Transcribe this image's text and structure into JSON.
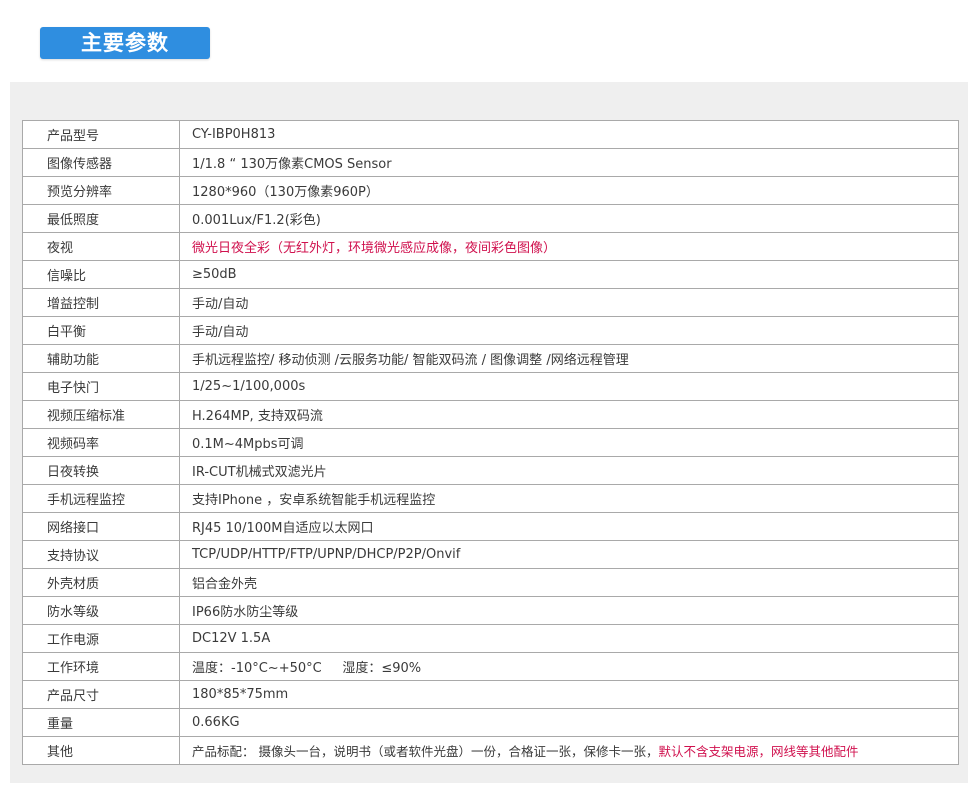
{
  "header": {
    "title": "主要参数"
  },
  "specs": [
    {
      "label": "产品型号",
      "value": "CY-IBP0H813"
    },
    {
      "label": "图像传感器",
      "value": "1/1.8 “ 130万像素CMOS Sensor"
    },
    {
      "label": "预览分辨率",
      "value": "1280*960（130万像素960P）"
    },
    {
      "label": "最低照度",
      "value": "0.001Lux/F1.2(彩色)"
    },
    {
      "label": "夜视",
      "value_highlight": "微光日夜全彩（无红外灯，环境微光感应成像，夜间彩色图像）"
    },
    {
      "label": "信噪比",
      "value": "≥50dB"
    },
    {
      "label": "增益控制",
      "value": "手动/自动"
    },
    {
      "label": "白平衡",
      "value": "手动/自动"
    },
    {
      "label": "辅助功能",
      "value": "手机远程监控/ 移动侦测 /云服务功能/ 智能双码流 / 图像调整 /网络远程管理"
    },
    {
      "label": "电子快门",
      "value": "1/25~1/100,000s"
    },
    {
      "label": "视频压缩标准",
      "value": "H.264MP, 支持双码流"
    },
    {
      "label": "视频码率",
      "value": "0.1M~4Mpbs可调"
    },
    {
      "label": "日夜转换",
      "value": "IR-CUT机械式双滤光片"
    },
    {
      "label": "手机远程监控",
      "value": "支持IPhone ，安卓系统智能手机远程监控"
    },
    {
      "label": "网络接口",
      "value": "RJ45 10/100M自适应以太网口"
    },
    {
      "label": "支持协议",
      "value": "TCP/UDP/HTTP/FTP/UPNP/DHCP/P2P/Onvif"
    },
    {
      "label": "外壳材质",
      "value": "铝合金外壳"
    },
    {
      "label": "防水等级",
      "value": "IP66防水防尘等级"
    },
    {
      "label": "工作电源",
      "value": "DC12V 1.5A"
    },
    {
      "label": "工作环境",
      "value": "温度：-10°C~+50°C     湿度：≤90%"
    },
    {
      "label": "产品尺寸",
      "value": "180*85*75mm"
    },
    {
      "label": "重量",
      "value": "0.66KG"
    },
    {
      "label": "其他",
      "value": "产品标配： 摄像头一台，说明书（或者软件光盘）一份，合格证一张，保修卡一张，",
      "value_highlight": "默认不含支架电源，网线等其他配件"
    }
  ],
  "colors": {
    "title_bg": "#2f8ee0",
    "panel_bg": "#efefef",
    "border": "#a9a9a9",
    "highlight_text": "#d0114e"
  }
}
